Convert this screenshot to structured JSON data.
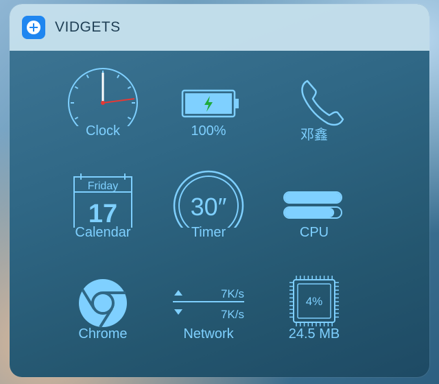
{
  "header": {
    "title": "VIDGETS",
    "icon": "plus-circle-icon"
  },
  "colors": {
    "accent": "#7fd0ff",
    "header_bg": "#cde6f2",
    "app_icon": "#1f86f0"
  },
  "widgets": {
    "clock": {
      "label": "Clock",
      "icon": "clock-icon"
    },
    "battery": {
      "label": "100%",
      "icon": "battery-charging-icon",
      "level": 1.0
    },
    "contact": {
      "label": "邓鑫",
      "icon": "phone-icon"
    },
    "calendar": {
      "label": "Calendar",
      "day_name": "Friday",
      "day_number": "17",
      "icon": "calendar-icon"
    },
    "timer": {
      "label": "Timer",
      "value": "30″",
      "icon": "timer-icon"
    },
    "cpu": {
      "label": "CPU",
      "icon": "cpu-bars-icon",
      "usage": [
        1.0,
        0.88
      ]
    },
    "chrome": {
      "label": "Chrome",
      "icon": "chrome-icon"
    },
    "network": {
      "label": "Network",
      "upload": "7K/s",
      "download": "7K/s",
      "icon": "network-icon"
    },
    "memory": {
      "label": "24.5 MB",
      "percent": "4%",
      "icon": "chip-icon"
    }
  }
}
